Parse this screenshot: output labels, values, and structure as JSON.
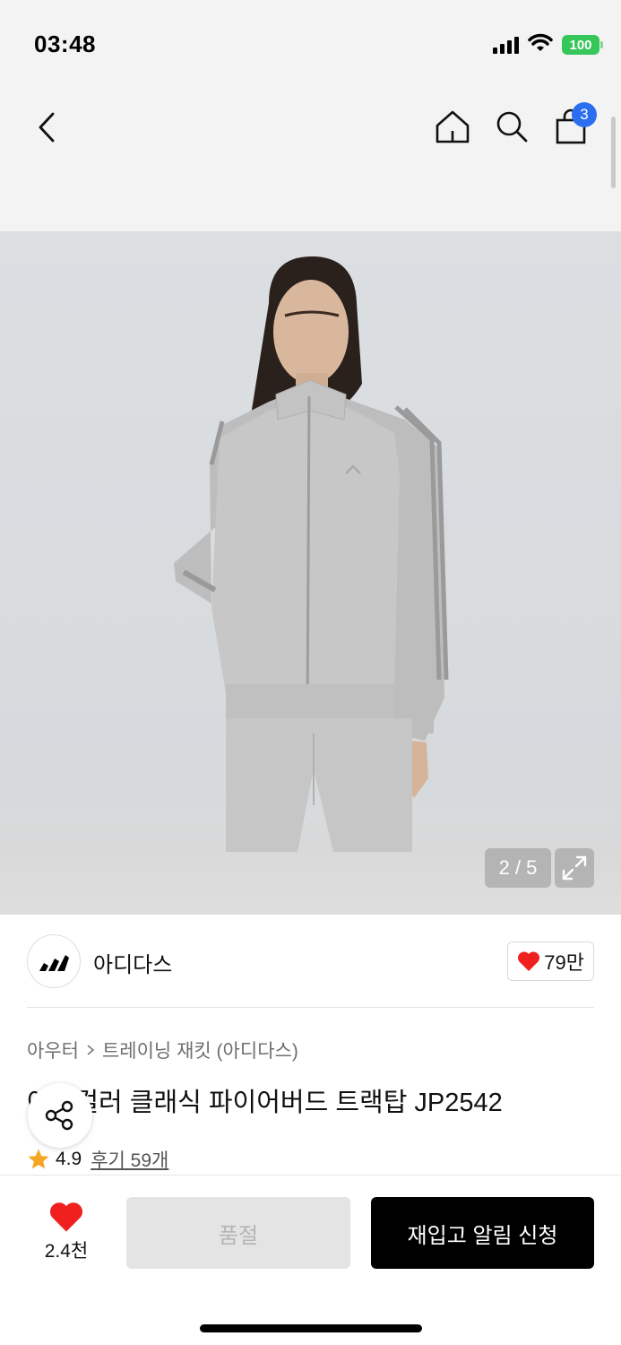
{
  "status_bar": {
    "time": "03:48",
    "battery": "100"
  },
  "nav": {
    "cart_count": "3"
  },
  "gallery": {
    "counter": "2 / 5"
  },
  "brand": {
    "name": "아디다스",
    "likes": "79만"
  },
  "product": {
    "breadcrumb_parent": "아우터",
    "breadcrumb_current": "트레이닝 재킷 (아디다스)",
    "title": "아디컬러 클래식 파이어버드 트랙탑 JP2542",
    "rating": "4.9",
    "reviews": "후기 59개"
  },
  "bottom_bar": {
    "wish_count": "2.4천",
    "sold_out_label": "품절",
    "restock_label": "재입고 알림 신청"
  },
  "colors": {
    "accent_red": "#f0201f",
    "badge_blue": "#2b6ff0",
    "star": "#f5a623",
    "battery_green": "#35c759"
  }
}
